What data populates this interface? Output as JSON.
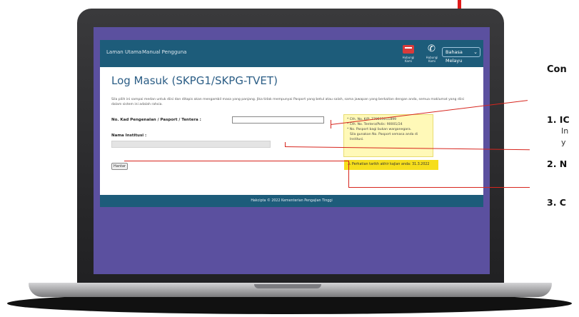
{
  "nav": {
    "home": "Laman Utama",
    "manual": "Manual Pengguna",
    "mail_label": "Hubungi Kami",
    "phone_label": "Hubungi Kami",
    "language": "Bahasa Melayu"
  },
  "form": {
    "title": "Log Masuk (SKPG1/SKPG-TVET)",
    "intro": "Sila pilih ini sampai medan untuk diisi dan ditapis akan mengambil masa yang panjang. Jika tidak mempunyai Pasport yang betul atau salah, sama jawapan yang berkaitan dengan anda, semua maklumat yang diisi dalam sistem ini adalah rahsia.",
    "id_label": "No. Kad Pengenalan / Pasport / Tentera :",
    "institution_label": "Nama Institusi :",
    "submit_label": "Hantar"
  },
  "hint": {
    "line1": "* Cth. No. K/P: 770511011899",
    "line2": "* Cth. No. Tentera/Polis: 90001/24",
    "line3": "* No. Pasport bagi bukan warganegara.",
    "line4": "Sila gunakan No. Pasport semasa anda di",
    "line5": "Institusi."
  },
  "warning": {
    "text": "Perhatian tarikh akhir kajian anda: 31.3.2022"
  },
  "footer": {
    "text": "Hakcipta © 2022 Kementerian Pengajian Tinggi"
  },
  "side": {
    "heading": "Con",
    "item1": "1. IC",
    "item1_sub1": "In",
    "item1_sub2": "y",
    "item2": "2. N",
    "item3": "3. C"
  },
  "colors": {
    "screen_bg": "#5b509f",
    "header_bg": "#1d5c7a",
    "annotation": "#d7261e",
    "title": "#2c5e86",
    "hint_bg": "#fff9b8",
    "warning_bg": "#f6de1c"
  }
}
